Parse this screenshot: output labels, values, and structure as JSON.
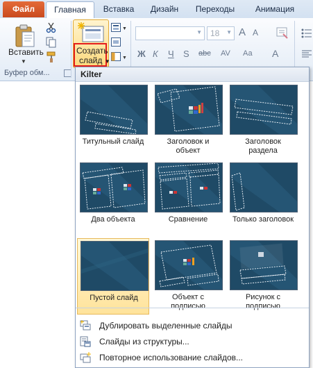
{
  "tabs": {
    "file": "Файл",
    "home": "Главная",
    "insert": "Вставка",
    "design": "Дизайн",
    "transitions": "Переходы",
    "animation": "Анимация"
  },
  "ribbon": {
    "paste_label": "Вставить",
    "clipboard_group": "Буфер обм...",
    "new_slide_line1": "Создать",
    "new_slide_line2": "слайд",
    "font_size_value": "18",
    "format_glyphs": [
      "Ж",
      "К",
      "Ч",
      "S",
      "abc",
      "AV",
      "Аа",
      "A"
    ],
    "grow_font": "A",
    "shrink_font": "A"
  },
  "gallery": {
    "title": "Kilter",
    "layouts": [
      {
        "label_line1": "Титульный слайд",
        "label_line2": ""
      },
      {
        "label_line1": "Заголовок и",
        "label_line2": "объект"
      },
      {
        "label_line1": "Заголовок",
        "label_line2": "раздела"
      },
      {
        "label_line1": "Два объекта",
        "label_line2": ""
      },
      {
        "label_line1": "Сравнение",
        "label_line2": ""
      },
      {
        "label_line1": "Только заголовок",
        "label_line2": ""
      },
      {
        "label_line1": "Пустой слайд",
        "label_line2": ""
      },
      {
        "label_line1": "Объект с",
        "label_line2": "подписью"
      },
      {
        "label_line1": "Рисунок с",
        "label_line2": "подписью"
      }
    ],
    "selected_index": 6
  },
  "menu": [
    {
      "icon": "duplicate-slides-icon",
      "text": "Дублировать выделенные слайды"
    },
    {
      "icon": "slides-from-outline-icon",
      "text": "Слайды из структуры..."
    },
    {
      "icon": "reuse-slides-icon",
      "text": "Повторное использование слайдов..."
    }
  ],
  "colors": {
    "file_tab": "#d4582a",
    "slide_bg": "#1f4a66",
    "selected_tile": "#ffe39b",
    "highlight_box": "#e41d1d"
  }
}
